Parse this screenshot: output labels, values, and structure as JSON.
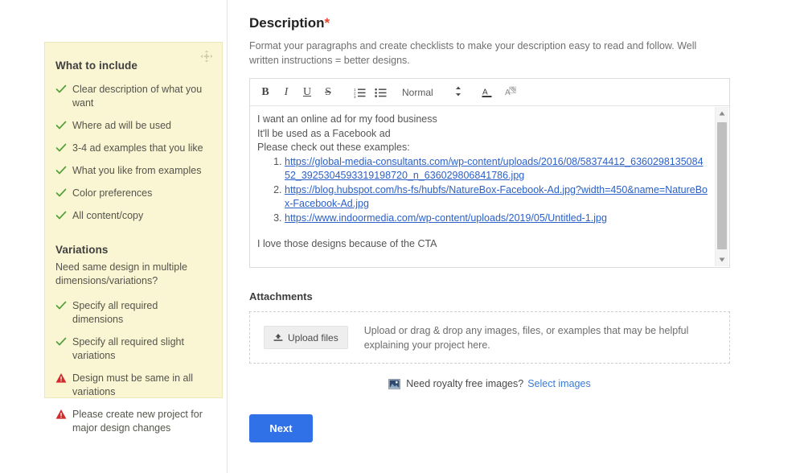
{
  "sidebar": {
    "drag_handle_icon": "move-arrows-icon",
    "include": {
      "heading": "What to include",
      "items": [
        {
          "icon": "check-icon",
          "type": "check",
          "text": "Clear description of what you want"
        },
        {
          "icon": "check-icon",
          "type": "check",
          "text": "Where ad will be used"
        },
        {
          "icon": "check-icon",
          "type": "check",
          "text": "3-4 ad examples that you like"
        },
        {
          "icon": "check-icon",
          "type": "check",
          "text": "What you like from examples"
        },
        {
          "icon": "check-icon",
          "type": "check",
          "text": "Color preferences"
        },
        {
          "icon": "check-icon",
          "type": "check",
          "text": "All content/copy"
        }
      ]
    },
    "variations": {
      "heading": "Variations",
      "subtext": "Need same design in multiple dimensions/variations?",
      "items": [
        {
          "icon": "check-icon",
          "type": "check",
          "text": "Specify all required dimensions"
        },
        {
          "icon": "check-icon",
          "type": "check",
          "text": "Specify all required slight variations"
        },
        {
          "icon": "warning-icon",
          "type": "warning",
          "text": "Design must be same in all variations"
        },
        {
          "icon": "warning-icon",
          "type": "warning",
          "text": "Please create new project for major design changes"
        }
      ]
    }
  },
  "main": {
    "title": "Description",
    "required_marker": "*",
    "helper_text": "Format your paragraphs and create checklists to make your description easy to read and follow. Well written instructions = better designs.",
    "editor": {
      "toolbar": {
        "bold": "B",
        "italic": "I",
        "underline": "U",
        "strikethrough": "S",
        "ordered_list_icon": "ordered-list-icon",
        "bullet_list_icon": "bullet-list-icon",
        "format_select_value": "Normal",
        "format_select_caret": "↕",
        "text_color_icon": "text-color-icon",
        "clear_format_icon": "clear-formatting-icon"
      },
      "content": {
        "line1": "I want an online ad for my food business",
        "line2": "It'll be used as a Facebook ad",
        "line3": "Please check out these examples:",
        "links": [
          "https://global-media-consultants.com/wp-content/uploads/2016/08/58374412_636029813508452_3925304593319198720_n_636029806841786.jpg",
          "https://blog.hubspot.com/hs-fs/hubfs/NatureBox-Facebook-Ad.jpg?width=450&name=NatureBox-Facebook-Ad.jpg",
          "https://www.indoormedia.com/wp-content/uploads/2019/05/Untitled-1.jpg"
        ],
        "closing": "I love those designs because of the CTA"
      },
      "scrollbar": {
        "up_arrow_icon": "scroll-up-arrow-icon",
        "down_arrow_icon": "scroll-down-arrow-icon"
      }
    },
    "attachments": {
      "title": "Attachments",
      "upload_button_label": "Upload files",
      "upload_button_icon": "upload-icon",
      "dropzone_text": "Upload or drag & drop any images, files, or examples that may be helpful explaining your project here."
    },
    "royalty": {
      "icon": "image-icon",
      "text": "Need royalty free images?",
      "link_label": "Select images"
    },
    "next_button_label": "Next"
  },
  "colors": {
    "sidebar_bg": "#faf5d2",
    "check_green": "#53a03b",
    "warning_red": "#d22b2b",
    "link_blue": "#2a60c8",
    "primary_blue": "#3071e8",
    "required_red": "#e8452c"
  }
}
